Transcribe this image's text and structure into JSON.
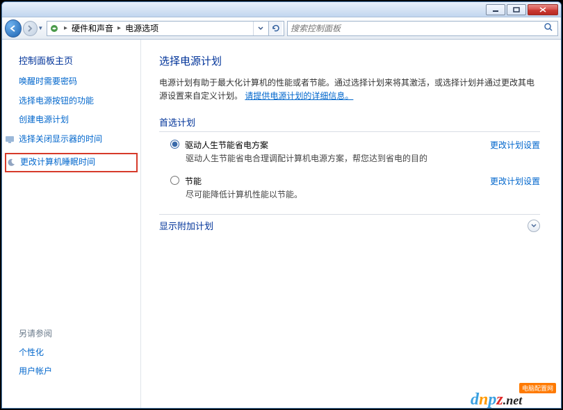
{
  "breadcrumb": {
    "segment1": "硬件和声音",
    "segment2": "电源选项"
  },
  "search": {
    "placeholder": "搜索控制面板"
  },
  "sidebar": {
    "heading": "控制面板主页",
    "links": [
      {
        "label": "唤醒时需要密码"
      },
      {
        "label": "选择电源按钮的功能"
      },
      {
        "label": "创建电源计划"
      },
      {
        "label": "选择关闭显示器的时间",
        "icon": "monitor-icon"
      },
      {
        "label": "更改计算机睡眠时间",
        "icon": "moon-icon",
        "highlighted": true
      }
    ],
    "see_also_heading": "另请参阅",
    "see_also": [
      {
        "label": "个性化"
      },
      {
        "label": "用户帐户"
      }
    ]
  },
  "main": {
    "title": "选择电源计划",
    "description_prefix": "电源计划有助于最大化计算机的性能或者节能。通过选择计划来将其激活，或选择计划并通过更改其电源设置来自定义计划。",
    "description_link": "请提供电源计划的详细信息。",
    "preferred_heading": "首选计划",
    "plans": [
      {
        "name": "驱动人生节能省电方案",
        "desc": "驱动人生节能省电合理调配计算机电源方案，帮您达到省电的目的",
        "action": "更改计划设置",
        "checked": true
      },
      {
        "name": "节能",
        "desc": "尽可能降低计算机性能以节能。",
        "action": "更改计划设置",
        "checked": false
      }
    ],
    "expander_label": "显示附加计划"
  },
  "watermark": {
    "tag": "电脑配置网",
    "domain_net": ".net"
  }
}
